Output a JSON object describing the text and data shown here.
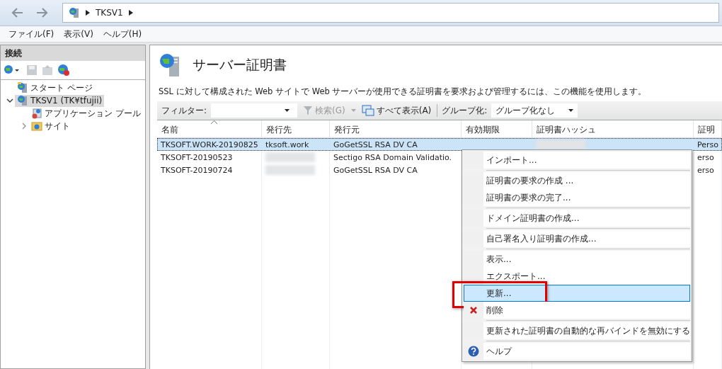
{
  "address_bar": {
    "crumbs": [
      "TKSV1"
    ]
  },
  "menu_bar": [
    "ファイル(F)",
    "表示(V)",
    "ヘルプ(H)"
  ],
  "connections": {
    "title": "接続",
    "tree": [
      {
        "label": "スタート ページ",
        "kind": "start",
        "selected": false
      },
      {
        "label": "TKSV1 (TK¥tfujii)",
        "kind": "server",
        "selected": true,
        "expanded": true,
        "children": [
          {
            "label": "アプリケーション プール",
            "kind": "pool",
            "selected": false
          },
          {
            "label": "サイト",
            "kind": "sites",
            "selected": false,
            "expanded": false
          }
        ]
      }
    ]
  },
  "page": {
    "title": "サーバー証明書",
    "description": "SSL に対して構成された Web サイトで Web サーバーが使用できる証明書を要求および管理するには、この機能を使用します。"
  },
  "filter_bar": {
    "filter_label": "フィルター:",
    "search": "検索(G)",
    "search_disabled": true,
    "show_all": "すべて表示(A)",
    "group_label": "グループ化:",
    "group_value": "グループ化なし"
  },
  "table": {
    "columns": [
      "名前",
      "発行先",
      "発行元",
      "有効期限",
      "証明書ハッシュ",
      "証明"
    ],
    "rows": [
      {
        "selected": true,
        "cells": [
          "TKSOFT.WORK-20190825",
          "tksoft.work",
          "GoGetSSL RSA DV CA",
          "",
          "",
          "Perso"
        ]
      },
      {
        "selected": false,
        "cells": [
          "TKSOFT-20190523",
          "",
          "Sectigo RSA Domain Validatio.",
          "",
          "",
          "erso"
        ]
      },
      {
        "selected": false,
        "cells": [
          "TKSOFT-20190724",
          "",
          "GoGetSSL RSA DV CA",
          "",
          "",
          "erso"
        ]
      }
    ]
  },
  "context_menu": [
    {
      "kind": "item",
      "label": "インポート...",
      "selected": false,
      "annotated": false
    },
    {
      "kind": "separator"
    },
    {
      "kind": "item",
      "label": "証明書の要求の作成 ...",
      "selected": false,
      "annotated": false
    },
    {
      "kind": "item",
      "label": "証明書の要求の完了...",
      "selected": false,
      "annotated": false
    },
    {
      "kind": "separator"
    },
    {
      "kind": "item",
      "label": "ドメイン証明書の作成...",
      "selected": false,
      "annotated": false
    },
    {
      "kind": "separator"
    },
    {
      "kind": "item",
      "label": "自己署名入り証明書の作成...",
      "selected": false,
      "annotated": false
    },
    {
      "kind": "separator"
    },
    {
      "kind": "item",
      "label": "表示...",
      "selected": false,
      "annotated": false
    },
    {
      "kind": "item",
      "label": "エクスポート...",
      "selected": false,
      "annotated": false
    },
    {
      "kind": "item",
      "label": "更新...",
      "selected": true,
      "annotated": true
    },
    {
      "kind": "delete",
      "label": "削除",
      "selected": false,
      "annotated": false
    },
    {
      "kind": "separator"
    },
    {
      "kind": "item",
      "label": "更新された証明書の自動的な再バインドを無効にする",
      "selected": false,
      "annotated": false
    },
    {
      "kind": "separator"
    },
    {
      "kind": "help",
      "label": "ヘルプ",
      "selected": false,
      "annotated": false
    }
  ]
}
